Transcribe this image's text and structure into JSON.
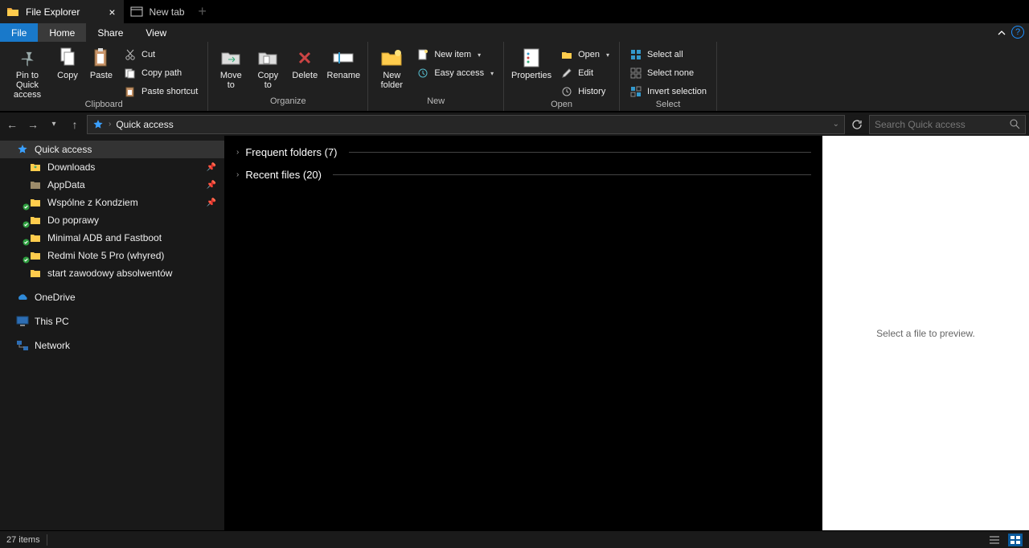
{
  "tabs": [
    {
      "title": "File Explorer",
      "active": true,
      "icon": "folder"
    },
    {
      "title": "New tab",
      "active": false,
      "icon": "window"
    }
  ],
  "menu": {
    "file": "File",
    "home": "Home",
    "share": "Share",
    "view": "View"
  },
  "ribbon": {
    "clipboard": {
      "label": "Clipboard",
      "pin": "Pin to Quick\naccess",
      "copy": "Copy",
      "paste": "Paste",
      "cut": "Cut",
      "copypath": "Copy path",
      "pasteshortcut": "Paste shortcut"
    },
    "organize": {
      "label": "Organize",
      "moveto": "Move\nto",
      "copyto": "Copy\nto",
      "delete": "Delete",
      "rename": "Rename"
    },
    "new": {
      "label": "New",
      "newfolder": "New\nfolder",
      "newitem": "New item",
      "easyaccess": "Easy access"
    },
    "open": {
      "label": "Open",
      "properties": "Properties",
      "open": "Open",
      "edit": "Edit",
      "history": "History"
    },
    "select": {
      "label": "Select",
      "selectall": "Select all",
      "selectnone": "Select none",
      "invert": "Invert selection"
    }
  },
  "address": {
    "location": "Quick access"
  },
  "search": {
    "placeholder": "Search Quick access"
  },
  "sidebar": {
    "quickaccess": "Quick access",
    "items": [
      {
        "label": "Downloads",
        "icon": "download",
        "pin": true,
        "sync": false
      },
      {
        "label": "AppData",
        "icon": "folder-dark",
        "pin": true,
        "sync": false
      },
      {
        "label": "Wspólne z Kondziem",
        "icon": "folder",
        "pin": true,
        "sync": true
      },
      {
        "label": "Do poprawy",
        "icon": "folder",
        "pin": false,
        "sync": true
      },
      {
        "label": "Minimal ADB and Fastboot",
        "icon": "folder",
        "pin": false,
        "sync": true
      },
      {
        "label": "Redmi Note 5 Pro (whyred)",
        "icon": "folder",
        "pin": false,
        "sync": true
      },
      {
        "label": "start zawodowy absolwentów",
        "icon": "folder",
        "pin": false,
        "sync": false
      }
    ],
    "onedrive": "OneDrive",
    "thispc": "This PC",
    "network": "Network"
  },
  "content": {
    "frequent": "Frequent folders (7)",
    "recent": "Recent files (20)"
  },
  "preview": {
    "empty": "Select a file to preview."
  },
  "status": {
    "items": "27 items"
  }
}
